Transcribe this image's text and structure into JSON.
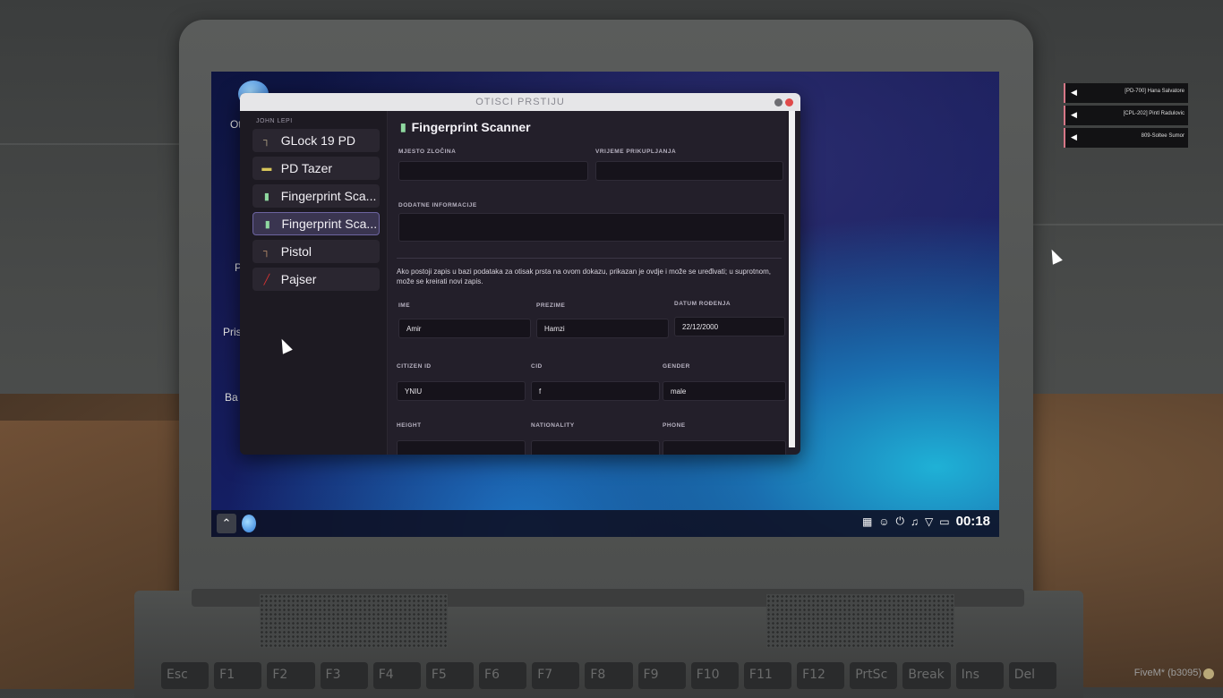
{
  "window": {
    "title": "OTISCI PRSTIJU",
    "owner_label": "JOHN LEPI"
  },
  "sidebar": {
    "items": [
      {
        "label": "GLock 19 PD",
        "icon": "pistol-icon"
      },
      {
        "label": "PD Tazer",
        "icon": "taser-icon"
      },
      {
        "label": "Fingerprint Sca...",
        "icon": "fingerprint-scanner-icon"
      },
      {
        "label": "Fingerprint Sca...",
        "icon": "fingerprint-scanner-icon",
        "active": true
      },
      {
        "label": "Pistol",
        "icon": "pistol-icon"
      },
      {
        "label": "Pajser",
        "icon": "crowbar-icon"
      }
    ]
  },
  "main": {
    "title": "Fingerprint Scanner",
    "location_label": "MJESTO ZLOČINA",
    "time_label": "VRIJEME PRIKUPLJANJA",
    "additional_label": "DODATNE INFORMACIJE",
    "notice": "Ako postoji zapis u bazi podataka za otisak prsta na ovom dokazu, prikazan je ovdje i može se uređivati; u suprotnom, može se kreirati novi zapis.",
    "fields": {
      "ime_label": "IME",
      "ime_value": "Amir",
      "prezime_label": "PREZIME",
      "prezime_value": "Hamzi",
      "datum_label": "DATUM ROĐENJA",
      "datum_value": "22/12/2000",
      "citizen_label": "CITIZEN ID",
      "citizen_value": "YNIU",
      "cid_label": "CID",
      "cid_value": "f",
      "gender_label": "GENDER",
      "gender_value": "male",
      "height_label": "HEIGHT",
      "nationality_label": "NATIONALITY",
      "phone_label": "PHONE"
    }
  },
  "taskbar": {
    "clock": "00:18"
  },
  "desktop_labels": [
    "Ot",
    "P",
    "Pris",
    "Ba"
  ],
  "voice_list": [
    {
      "text": "[PD-700] Hana Salvatore"
    },
    {
      "text": "[CPL-202] Pintl Radulovic"
    },
    {
      "text": "809-Soltee Sumor"
    }
  ],
  "keyboard": [
    "Esc",
    "F1",
    "F2",
    "F3",
    "F4",
    "F5",
    "F6",
    "F7",
    "F8",
    "F9",
    "F10",
    "F11",
    "F12",
    "PrtSc",
    "Break",
    "Ins",
    "Del"
  ],
  "footer": {
    "brand": "FiveM* (b3095)"
  }
}
